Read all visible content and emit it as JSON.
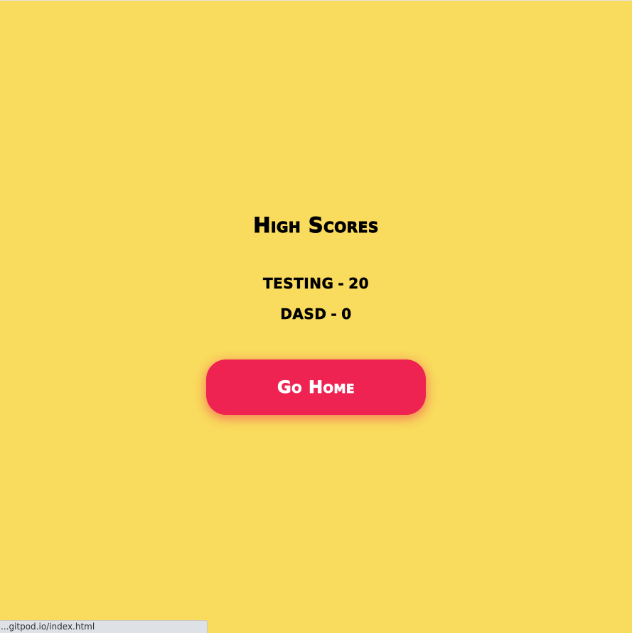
{
  "page": {
    "title": "High Scores",
    "background_color": "#F9DB5D"
  },
  "scores": [
    {
      "name": "TESTING",
      "separator": "-",
      "score": "20"
    },
    {
      "name": "DASD",
      "separator": "-",
      "score": "0"
    }
  ],
  "home_button": {
    "label": "Go Home",
    "color": "#EF2351"
  },
  "status_bar": {
    "url": "...gitpod.io/index.html"
  }
}
